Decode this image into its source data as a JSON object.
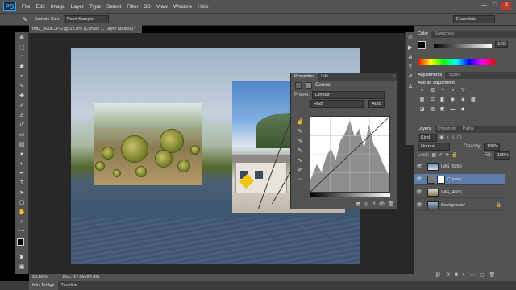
{
  "app": {
    "logo": "PS"
  },
  "menu": [
    "File",
    "Edit",
    "Image",
    "Layer",
    "Type",
    "Select",
    "Filter",
    "3D",
    "View",
    "Window",
    "Help"
  ],
  "window_controls": [
    "—",
    "□",
    "✕"
  ],
  "options_bar": {
    "sample_size_label": "Sample Size:",
    "sample_size_value": "Point Sample",
    "workspace": "Essentials"
  },
  "document": {
    "tab_title": "IMG_4006.JPG @ 26.8% (Curves 1, Layer Mask/8) *",
    "zoom": "26.82%",
    "doc_info": "Doc: 17.0M/27.0M"
  },
  "bottom_tabs": [
    "Mini Bridge",
    "Timeline"
  ],
  "properties": {
    "tabs": [
      "Properties",
      "Info"
    ],
    "title": "Curves",
    "preset_label": "Preset:",
    "preset_value": "Default",
    "channel": "RGB",
    "auto_label": "Auto"
  },
  "color_panel": {
    "tabs": [
      "Color",
      "Swatches"
    ],
    "value_label": "100"
  },
  "adjustments": {
    "tabs": [
      "Adjustments",
      "Styles"
    ],
    "title": "Add an adjustment"
  },
  "layers_panel": {
    "tabs": [
      "Layers",
      "Channels",
      "Paths"
    ],
    "kind_label": "Kind",
    "blend_mode": "Normal",
    "opacity_label": "Opacity:",
    "opacity_value": "100%",
    "lock_label": "Lock:",
    "fill_label": "Fill:",
    "fill_value": "100%",
    "layers": [
      {
        "name": "IMG_5050",
        "visible": true
      },
      {
        "name": "Curves 1",
        "visible": true
      },
      {
        "name": "IMG_4005",
        "visible": true
      },
      {
        "name": "Background",
        "visible": true
      }
    ]
  },
  "colors": {
    "ui_dark": "#535353",
    "ui_darker": "#3f3f3f",
    "canvas_bg": "#282828",
    "accent": "#31a8ff",
    "selected_row": "#5d7ca8"
  }
}
